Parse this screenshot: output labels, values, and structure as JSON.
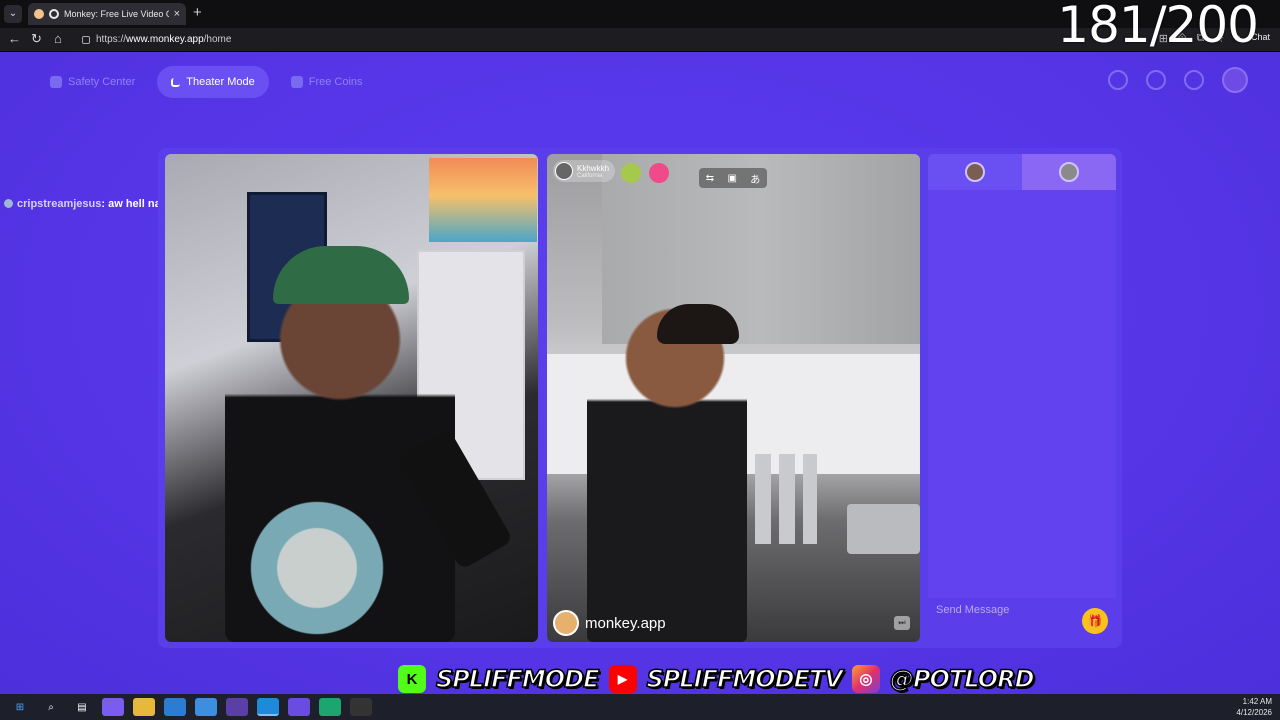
{
  "browser": {
    "tab_title": "Monkey: Free Live Video Chat",
    "tab_close": "×",
    "new_tab": "+",
    "url_prefix": "https://",
    "url_host": "www.monkey.app",
    "url_path": "/home",
    "ext_chat_label": "Chat"
  },
  "overlay": {
    "counter": "181/200",
    "chat_user": "cripstreamjesus",
    "chat_message": ": aw hell nah",
    "socials": [
      {
        "icon": "kick-icon",
        "label": "SPLIFFMODE",
        "color": "#53fc18",
        "glyph": "K"
      },
      {
        "icon": "youtube-icon",
        "label": "SPLIFFMODETV",
        "color": "#ff0000",
        "glyph": "▶"
      },
      {
        "icon": "instagram-icon",
        "label": "@POTLORD",
        "color": "#e1306c",
        "glyph": "◎"
      }
    ]
  },
  "page": {
    "nav": {
      "safety_center": "Safety Center",
      "theater_mode": "Theater Mode",
      "free_coins": "Free Coins"
    },
    "remote": {
      "name": "Kkhwkkh",
      "location": "California"
    },
    "brand": "monkey.app",
    "chat_placeholder": "Send Message"
  },
  "taskbar": {
    "time": "1:42 AM",
    "date": "4/12/2026"
  },
  "colors": {
    "page_bg": "#5535e6",
    "accent": "#6a4ff3",
    "gift": "#f7c21b"
  }
}
